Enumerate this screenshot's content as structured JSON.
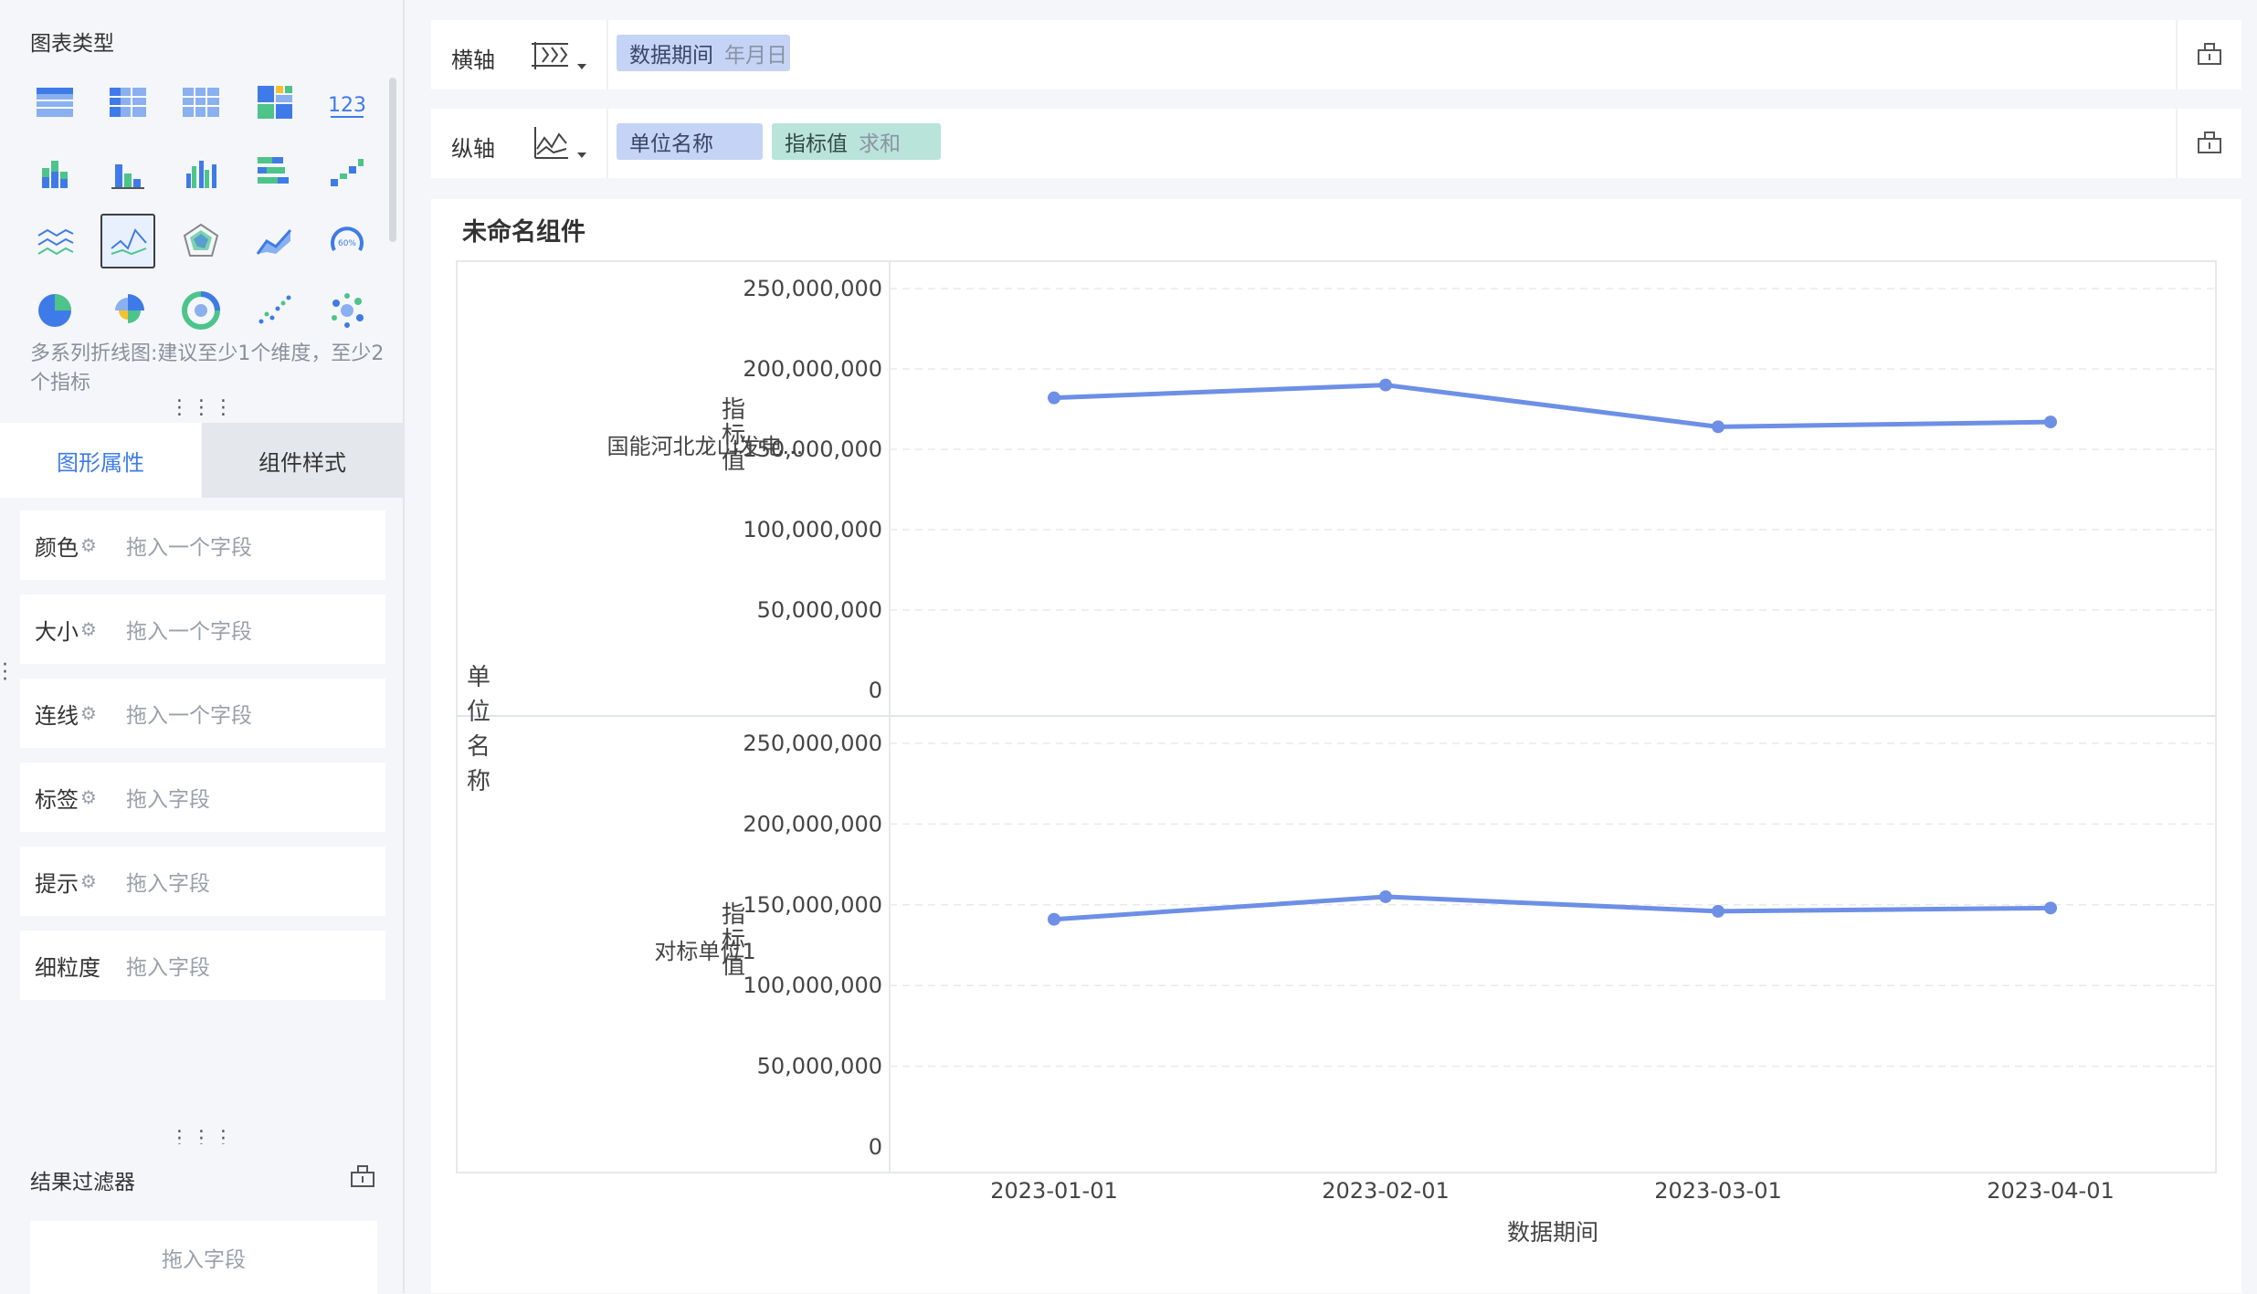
{
  "left_panel": {
    "chart_type_title": "图表类型",
    "chart_types": [
      {
        "name": "table-icon"
      },
      {
        "name": "cross-table-icon"
      },
      {
        "name": "detail-table-icon"
      },
      {
        "name": "treemap-color-table-icon"
      },
      {
        "name": "kpi-number-icon"
      },
      {
        "name": "stacked-bar-icon"
      },
      {
        "name": "bar-chart-icon"
      },
      {
        "name": "grouped-bar-icon"
      },
      {
        "name": "horizontal-bar-icon"
      },
      {
        "name": "waterfall-icon"
      },
      {
        "name": "multi-line-icon"
      },
      {
        "name": "line-chart-icon",
        "selected": true
      },
      {
        "name": "radar-icon"
      },
      {
        "name": "area-chart-icon"
      },
      {
        "name": "gauge-icon"
      },
      {
        "name": "pie-icon"
      },
      {
        "name": "rose-pie-icon"
      },
      {
        "name": "donut-icon"
      },
      {
        "name": "scatter-icon"
      },
      {
        "name": "bubble-icon"
      }
    ],
    "gauge_text": "60%",
    "kpi_text": "123",
    "hint": "多系列折线图:建议至少1个维度，至少2个指标",
    "tabs": {
      "active": "图形属性",
      "inactive": "组件样式"
    },
    "properties": [
      {
        "label": "颜色",
        "placeholder": "拖入一个字段",
        "gear": true
      },
      {
        "label": "大小",
        "placeholder": "拖入一个字段",
        "gear": true
      },
      {
        "label": "连线",
        "placeholder": "拖入一个字段",
        "gear": true
      },
      {
        "label": "标签",
        "placeholder": "拖入字段",
        "gear": true
      },
      {
        "label": "提示",
        "placeholder": "拖入字段",
        "gear": true
      },
      {
        "label": "细粒度",
        "placeholder": "拖入字段",
        "gear": false
      }
    ],
    "filter": {
      "title": "结果过滤器",
      "placeholder": "拖入字段"
    }
  },
  "x_axis": {
    "label": "横轴",
    "pills": [
      {
        "text": "数据期间",
        "sub": "年月日",
        "color": "blue"
      }
    ]
  },
  "y_axis": {
    "label": "纵轴",
    "pills": [
      {
        "text": "单位名称",
        "sub": "",
        "color": "blue"
      },
      {
        "text": "指标值",
        "sub": "求和",
        "color": "green"
      }
    ]
  },
  "card": {
    "title": "未命名组件"
  },
  "colors": {
    "line": "#6d8fe6",
    "accent": "#3f7be8",
    "pill_blue": "#c5d3f6",
    "pill_green": "#b9e4da"
  },
  "chart_data": {
    "type": "line",
    "xlabel": "数据期间",
    "facet_label": "单位名称",
    "ylabel": "指标值",
    "x": [
      "2023-01-01",
      "2023-02-01",
      "2023-03-01",
      "2023-04-01"
    ],
    "ylim": [
      0,
      250000000
    ],
    "yticks": [
      "0",
      "50,000,000",
      "100,000,000",
      "150,000,000",
      "200,000,000",
      "250,000,000"
    ],
    "grid": true,
    "facets": [
      {
        "name": "国能河北龙山发电...",
        "values": [
          182000000,
          190000000,
          164000000,
          167000000
        ]
      },
      {
        "name": "对标单位1",
        "values": [
          141000000,
          155000000,
          146000000,
          148000000
        ]
      }
    ]
  }
}
